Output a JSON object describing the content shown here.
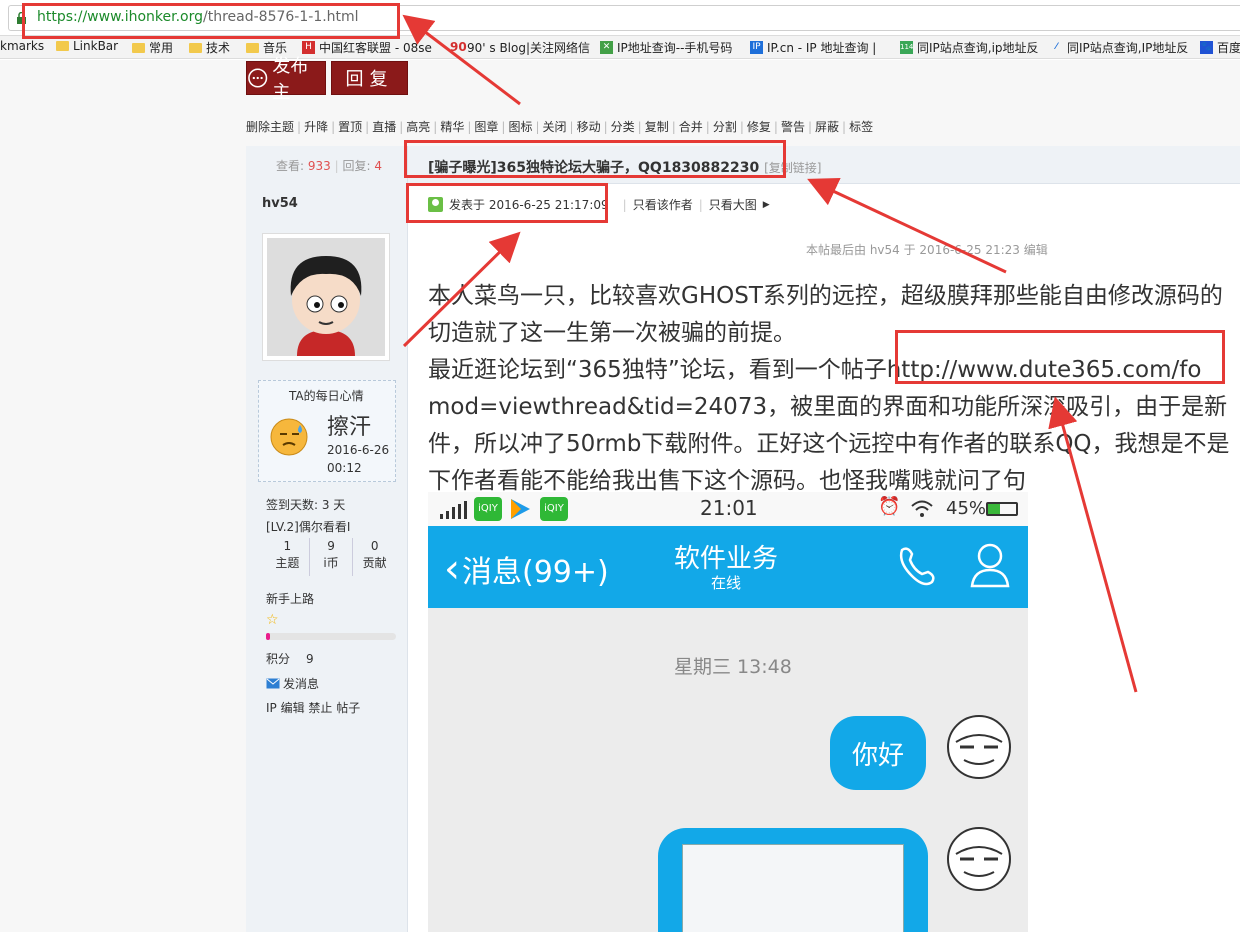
{
  "browser": {
    "url_scheme": "https://www.ihonker.org",
    "url_path": "/thread-8576-1-1.html",
    "bookmarks": [
      "kmarks",
      "LinkBar",
      "常用",
      "技术",
      "音乐",
      "中国红客联盟 - 08se",
      "90' s Blog|关注网络信",
      "IP地址查询--手机号码",
      "IP.cn - IP 地址查询 |",
      "同IP站点查询,ip地址反",
      "同IP站点查询,IP地址反",
      "百度"
    ]
  },
  "actions": {
    "post_label": "发布主",
    "reply_label": "回复"
  },
  "toolbar": [
    "删除主题",
    "升降",
    "置顶",
    "直播",
    "高亮",
    "精华",
    "图章",
    "图标",
    "关闭",
    "移动",
    "分类",
    "复制",
    "合并",
    "分割",
    "修复",
    "警告",
    "屏蔽",
    "标签"
  ],
  "thread": {
    "views_label": "查看:",
    "views": "933",
    "replies_label": "回复:",
    "replies": "4",
    "title": "[骗子曝光]365独特论坛大骗子，QQ1830882230",
    "copy_link": "[复制链接]",
    "posted_at": "发表于 2016-6-25 21:17:09",
    "only_author": "只看该作者",
    "only_big": "只看大图",
    "edit_note": "本帖最后由 hv54 于 2016-6-25 21:23 编辑",
    "body_lines": [
      "本人菜鸟一只，比较喜欢GHOST系列的远控，超级膜拜那些能自由修改源码的",
      "切造就了这一生第一次被骗的前提。",
      "最近逛论坛到“365独特”论坛，看到一个帖子http://www.dute365.com/fo",
      "mod=viewthread&tid=24073，被里面的界面和功能所深深吸引，由于是新",
      "件，所以冲了50rmb下载附件。正好这个远控中有作者的联系QQ，我想是不是",
      "下作者看能不能给我出售下这个源码。也怪我嘴贱就问了句"
    ]
  },
  "author": {
    "name": "hv54",
    "mood_title": "TA的每日心情",
    "mood": "擦汗",
    "mood_date": "2016-6-26",
    "mood_time": "00:12",
    "signin": "签到天数: 3 天",
    "level": "[LV.2]偶尔看看I",
    "stats": [
      {
        "value": "1",
        "label": "主题"
      },
      {
        "value": "9",
        "label": "i币"
      },
      {
        "value": "0",
        "label": "贡献"
      }
    ],
    "rank": "新手上路",
    "points_label": "积分",
    "points": "9",
    "send_msg": "发消息",
    "admin_links": "IP 编辑 禁止 帖子"
  },
  "phone": {
    "time": "21:01",
    "battery": "45%",
    "back_label": "消息(99+)",
    "chat_title": "软件业务",
    "chat_status": "在线",
    "day_label": "星期三 13:48",
    "msg1": "你好"
  },
  "colors": {
    "accent_red": "#8b1a1a",
    "phone_blue": "#12a8e8",
    "annotation_red": "#e53935"
  }
}
